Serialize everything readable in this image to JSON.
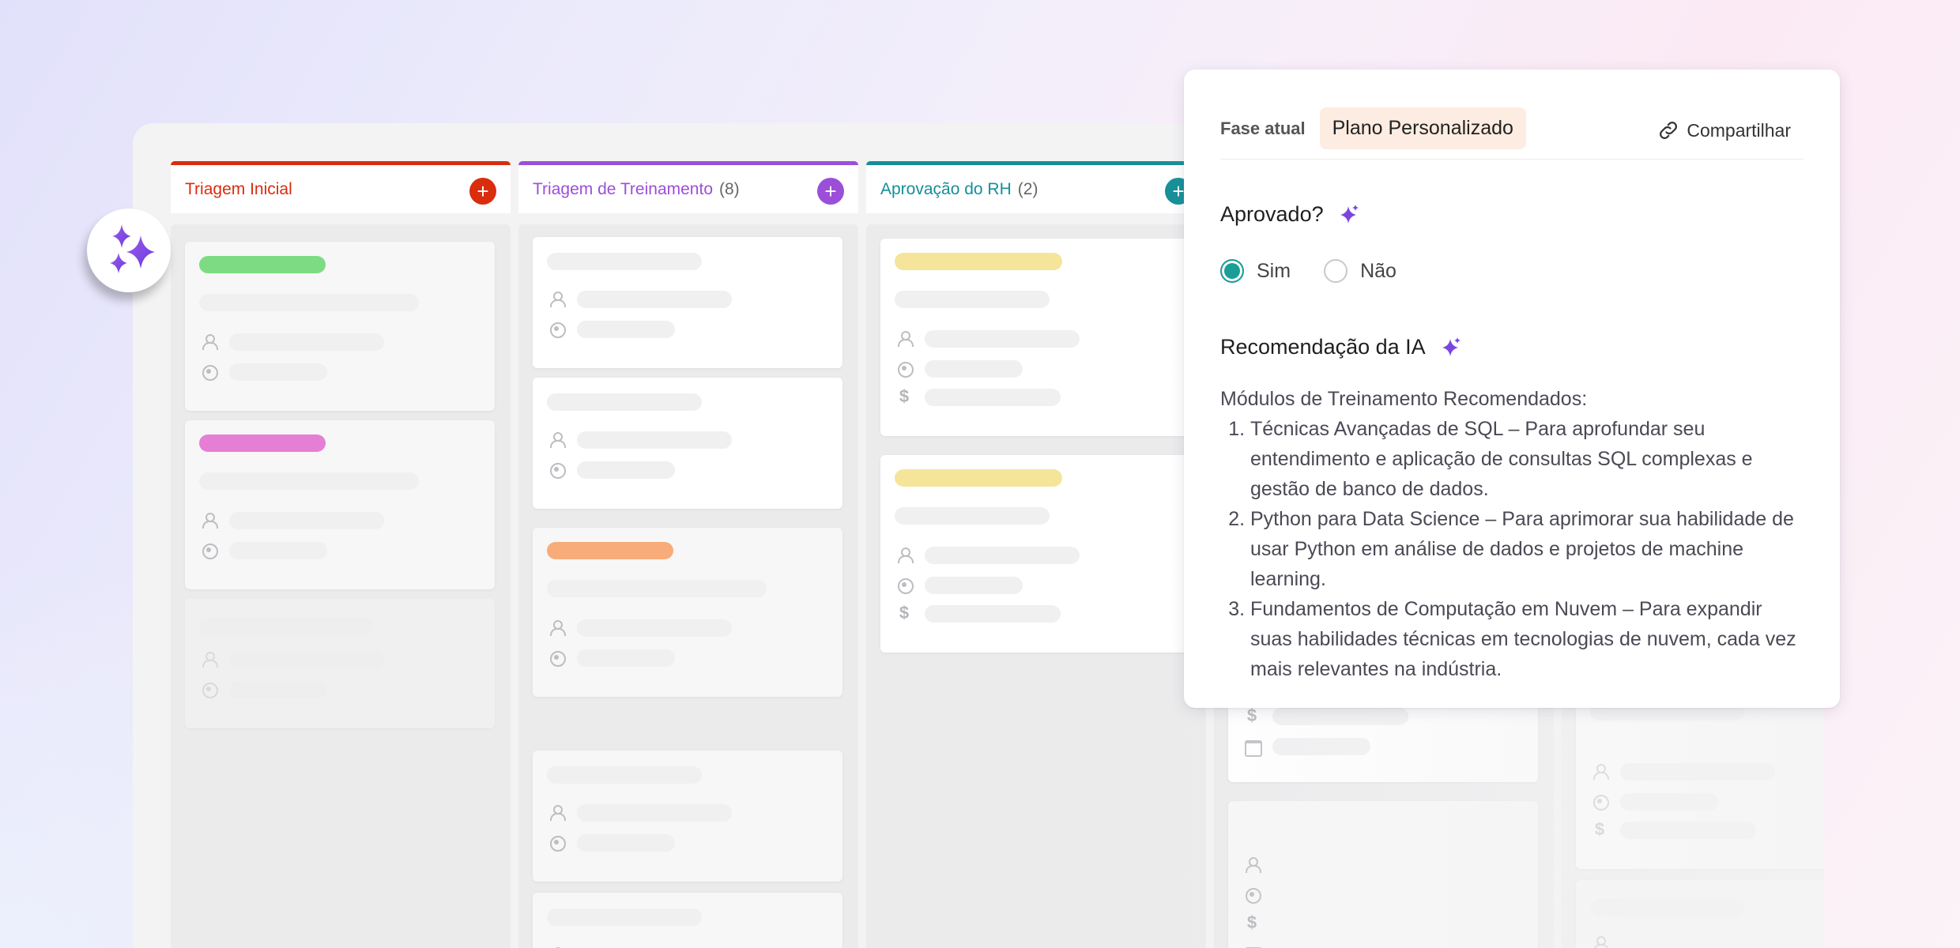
{
  "colors": {
    "red": "#d92d0e",
    "purple": "#9b4fd9",
    "teal": "#148f98",
    "radio_selected": "#1b9e97",
    "sparkle": "#7b45e0",
    "tag_green": "#7ddc83",
    "tag_pink": "#e57fd6",
    "tag_orange": "#f7ac7a",
    "tag_yellow": "#f5e59a",
    "phase_pill": "#fdece1"
  },
  "ai_button": {
    "icon": "sparkles-icon"
  },
  "columns": [
    {
      "title": "Triagem Inicial",
      "count": "",
      "accent": "red",
      "add_icon": "+"
    },
    {
      "title": "Triagem de Treinamento",
      "count": "(8)",
      "accent": "purple",
      "add_icon": "+"
    },
    {
      "title": "Aprovação do RH",
      "count": "(2)",
      "accent": "teal",
      "add_icon": "+"
    }
  ],
  "panel": {
    "phase_label": "Fase atual",
    "phase_value": "Plano Personalizado",
    "share_label": "Compartilhar",
    "share_icon": "link-icon",
    "approved_question": "Aprovado?",
    "approved_options": [
      "Sim",
      "Não"
    ],
    "approved_selected": "Sim",
    "recommendation_title": "Recomendação da IA",
    "recommendation_intro": "Módulos de Treinamento Recomendados:",
    "recommendation_items": [
      "Técnicas Avançadas de SQL – Para aprofundar seu entendimento e aplicação de consultas SQL complexas e gestão de banco de dados.",
      "Python para Data Science – Para aprimorar sua habilidade de usar Python em análise de dados e projetos de machine learning.",
      "Fundamentos de Computação em Nuvem – Para expandir suas habilidades técnicas em tecnologias de nuvem, cada vez mais relevantes na indústria."
    ]
  },
  "card_icons": [
    "person-icon",
    "target-icon",
    "dollar-icon",
    "calendar-icon"
  ],
  "dollar_glyph": "$"
}
